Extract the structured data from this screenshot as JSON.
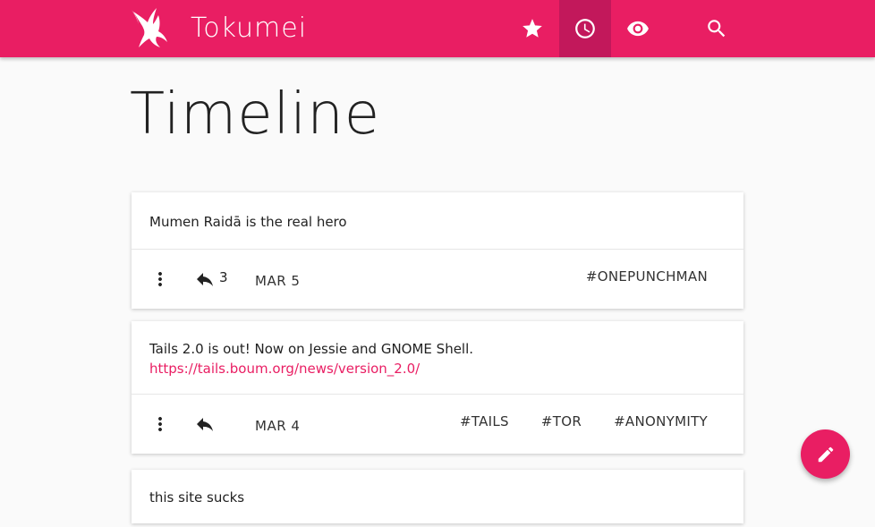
{
  "app": {
    "brand": "Tokumei",
    "accent": "#e91e63"
  },
  "nav": {
    "items": [
      {
        "icon": "star-icon",
        "active": false
      },
      {
        "icon": "clock-icon",
        "active": true
      },
      {
        "icon": "eye-icon",
        "active": false
      },
      {
        "icon": "search-icon",
        "active": false
      }
    ]
  },
  "page": {
    "title": "Timeline"
  },
  "posts": [
    {
      "text": "Mumen Raidā is the real hero",
      "link": "",
      "reply_count": "3",
      "date": "MAR 5",
      "tags": [
        "#ONEPUNCHMAN"
      ]
    },
    {
      "text": "Tails 2.0 is out! Now on Jessie and GNOME Shell.",
      "link": "https://tails.boum.org/news/version_2.0/",
      "reply_count": "",
      "date": "MAR 4",
      "tags": [
        "#TAILS",
        "#TOR",
        "#ANONYMITY"
      ]
    },
    {
      "text": "this site sucks",
      "link": "",
      "reply_count": "",
      "date": "",
      "tags": []
    }
  ],
  "fab": {
    "icon": "pencil-icon"
  }
}
